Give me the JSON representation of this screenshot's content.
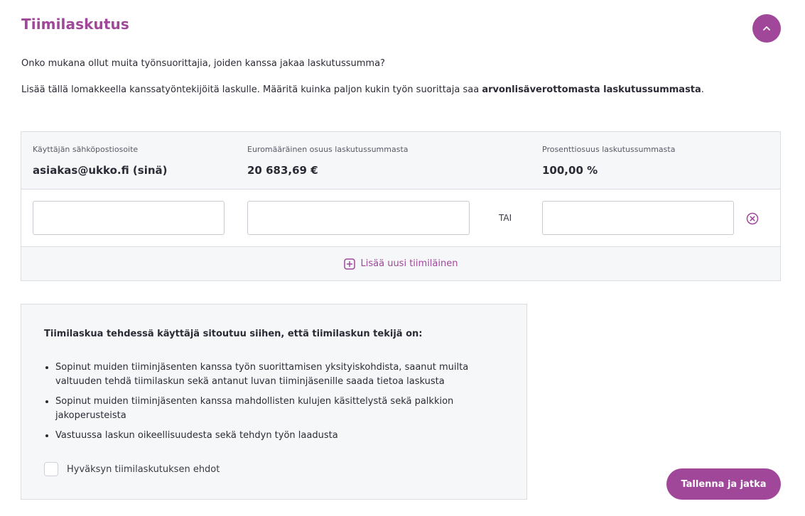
{
  "section": {
    "title": "Tiimilaskutus"
  },
  "intro": {
    "question": "Onko mukana ollut muita työnsuorittajia, joiden kanssa jakaa laskutussumma?",
    "instruction_prefix": "Lisää tällä lomakkeella kanssatyöntekijöitä laskulle. Määritä kuinka paljon kukin työn suorittaja saa ",
    "instruction_bold": "arvonlisäverottomasta laskutussummasta",
    "instruction_suffix": "."
  },
  "team_table": {
    "columns": {
      "email_label": "Käyttäjän sähköpostiosoite",
      "euro_label": "Euromääräinen osuus laskutussummasta",
      "percent_label": "Prosenttiosuus laskutussummasta"
    },
    "owner_row": {
      "email": "asiakas@ukko.fi (sinä)",
      "euro_share": "20 683,69 €",
      "percent_share": "100,00 %"
    },
    "member_rows": [
      {
        "email": "",
        "euro_share": "",
        "or_label": "TAI",
        "percent_share": ""
      }
    ],
    "add_member_label": "Lisää uusi tiimiläinen"
  },
  "terms": {
    "heading": "Tiimilaskua tehdessä käyttäjä sitoutuu siihen, että tiimilaskun tekijä on:",
    "items": [
      "Sopinut muiden tiiminjäsenten kanssa työn suorittamisen yksityiskohdista, saanut muilta valtuuden tehdä tiimilaskun sekä antanut luvan tiiminjäsenille saada tietoa laskusta",
      "Sopinut muiden tiiminjäsenten kanssa mahdollisten kulujen käsittelystä sekä palkkion jakoperusteista",
      "Vastuussa laskun oikeellisuudesta sekä tehdyn työn laadusta"
    ],
    "accept_label": "Hyväksyn tiimilaskutuksen ehdot",
    "accept_checked": false
  },
  "actions": {
    "save_label": "Tallenna ja jatka"
  },
  "icons": {
    "collapse": "chevron-up-icon",
    "remove": "remove-circle-icon",
    "add": "plus-square-icon"
  },
  "colors": {
    "accent": "#a0479a",
    "panel_background": "#f6f7f9",
    "border": "#dcdde3",
    "text": "#2b2b36"
  }
}
